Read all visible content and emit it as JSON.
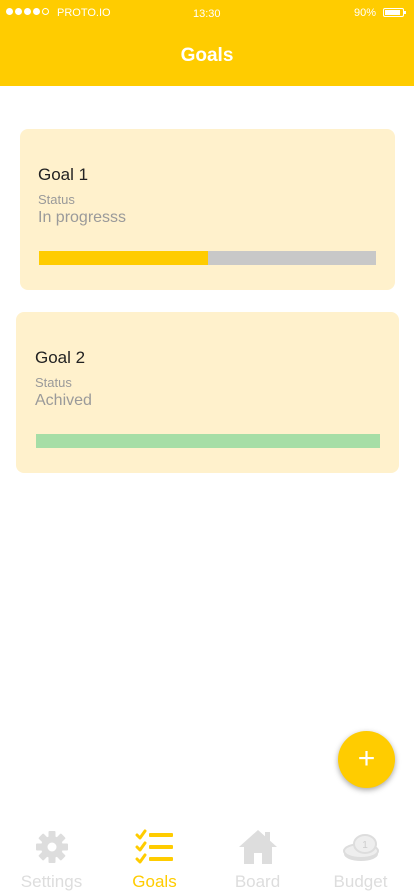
{
  "status_bar": {
    "carrier": "PROTO.IO",
    "time": "13:30",
    "battery": "90%",
    "battery_level": 0.9
  },
  "header": {
    "title": "Goals"
  },
  "goals": [
    {
      "title": "Goal 1",
      "status_label": "Status",
      "status_value": "In progresss",
      "progress": 0.5,
      "progress_color": "#ffcc00"
    },
    {
      "title": "Goal 2",
      "status_label": "Status",
      "status_value": "Achived",
      "progress": 1.0,
      "progress_color": "#a6dea6"
    }
  ],
  "fab": {
    "label": "+"
  },
  "tabs": [
    {
      "label": "Settings",
      "icon": "gear-icon",
      "active": false
    },
    {
      "label": "Goals",
      "icon": "checklist-icon",
      "active": true
    },
    {
      "label": "Board",
      "icon": "house-icon",
      "active": false
    },
    {
      "label": "Budget",
      "icon": "coins-icon",
      "active": false
    }
  ],
  "colors": {
    "accent": "#ffcc00",
    "card_bg": "#fff1cc",
    "inactive_tab": "#dddddd"
  }
}
